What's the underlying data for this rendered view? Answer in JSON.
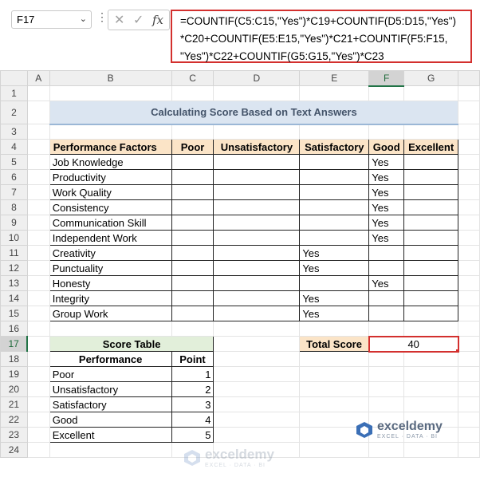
{
  "formula_bar": {
    "cell_ref": "F17",
    "formula_lines": [
      "=COUNTIF(C5:C15,\"Yes\")*C19+COUNTIF(D5:D15,\"Yes\")",
      "*C20+COUNTIF(E5:E15,\"Yes\")*C21+COUNTIF(F5:F15,",
      "\"Yes\")*C22+COUNTIF(G5:G15,\"Yes\")*C23"
    ]
  },
  "columns": [
    "A",
    "B",
    "C",
    "D",
    "E",
    "F",
    "G"
  ],
  "rows": [
    "1",
    "2",
    "3",
    "4",
    "5",
    "6",
    "7",
    "8",
    "9",
    "10",
    "11",
    "12",
    "13",
    "14",
    "15",
    "16",
    "17",
    "18",
    "19",
    "20",
    "21",
    "22",
    "23",
    "24"
  ],
  "title": "Calculating Score Based on Text Answers",
  "main_table": {
    "headers": [
      "Performance Factors",
      "Poor",
      "Unsatisfactory",
      "Satisfactory",
      "Good",
      "Excellent"
    ],
    "rows": [
      [
        "Job Knowledge",
        "",
        "",
        "",
        "Yes",
        ""
      ],
      [
        "Productivity",
        "",
        "",
        "",
        "Yes",
        ""
      ],
      [
        "Work Quality",
        "",
        "",
        "",
        "Yes",
        ""
      ],
      [
        "Consistency",
        "",
        "",
        "",
        "Yes",
        ""
      ],
      [
        "Communication Skill",
        "",
        "",
        "",
        "Yes",
        ""
      ],
      [
        "Independent Work",
        "",
        "",
        "",
        "Yes",
        ""
      ],
      [
        "Creativity",
        "",
        "",
        "Yes",
        "",
        ""
      ],
      [
        "Punctuality",
        "",
        "",
        "Yes",
        "",
        ""
      ],
      [
        "Honesty",
        "",
        "",
        "",
        "Yes",
        ""
      ],
      [
        "Integrity",
        "",
        "",
        "Yes",
        "",
        ""
      ],
      [
        "Group Work",
        "",
        "",
        "Yes",
        "",
        ""
      ]
    ]
  },
  "score_table": {
    "title": "Score Table",
    "headers": [
      "Performance",
      "Point"
    ],
    "rows": [
      [
        "Poor",
        "1"
      ],
      [
        "Unsatisfactory",
        "2"
      ],
      [
        "Satisfactory",
        "3"
      ],
      [
        "Good",
        "4"
      ],
      [
        "Excellent",
        "5"
      ]
    ]
  },
  "total": {
    "label": "Total Score",
    "value": "40"
  },
  "watermark": {
    "name": "exceldemy",
    "tagline": "EXCEL · DATA · BI"
  },
  "colors": {
    "accent_red": "#d3302e",
    "header_orange": "#fbe4c7",
    "score_green": "#e2efda",
    "title_blue": "#dbe5f1"
  }
}
